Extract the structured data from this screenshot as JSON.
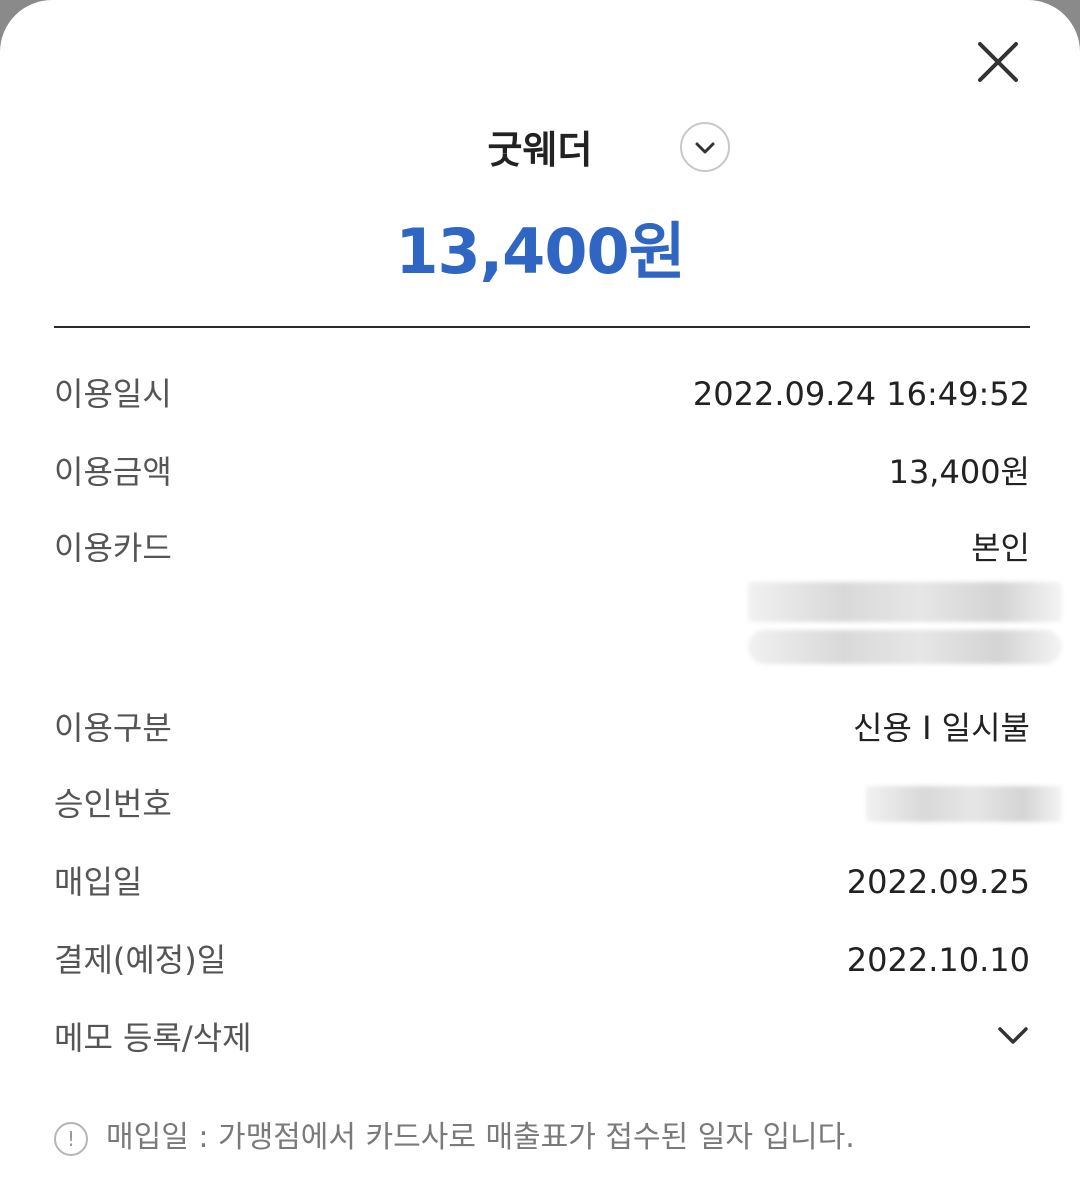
{
  "header": {
    "merchant_name": "굿웨더",
    "amount": "13,400원"
  },
  "icons": {
    "close": "close-icon",
    "expand": "chevron-down-icon",
    "info": "info-icon"
  },
  "colors": {
    "amount": "#2f66c4",
    "divider": "#2b2b2b"
  },
  "details": [
    {
      "label": "이용일시",
      "value": "2022.09.24 16:49:52"
    },
    {
      "label": "이용금액",
      "value": "13,400원"
    },
    {
      "label": "이용카드",
      "value": "본인"
    },
    {
      "label": "이용구분",
      "value": "신용 I 일시불"
    },
    {
      "label": "승인번호",
      "value": ""
    },
    {
      "label": "매입일",
      "value": "2022.09.25"
    },
    {
      "label": "결제(예정)일",
      "value": "2022.10.10"
    }
  ],
  "memo": {
    "label": "메모 등록/삭제"
  },
  "notice": {
    "icon_glyph": "!",
    "text": "매입일 : 가맹점에서 카드사로 매출표가 접수된 일자 입니다."
  }
}
